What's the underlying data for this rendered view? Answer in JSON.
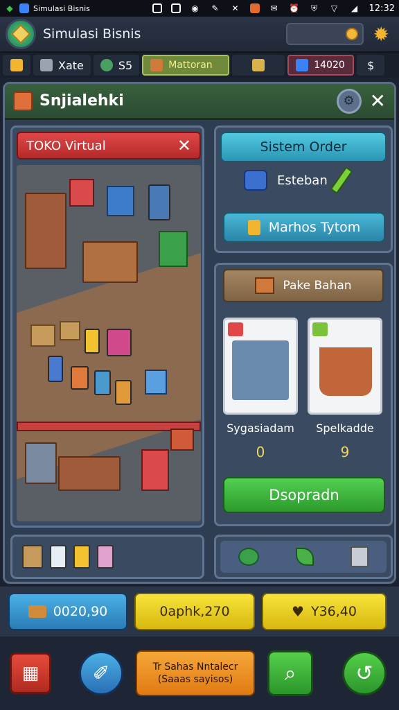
{
  "status_bar": {
    "app_name": "Simulasi Bisnis",
    "time": "12:32"
  },
  "header": {
    "title": "Simulasi Bisnis"
  },
  "resources": [
    {
      "label": "",
      "icon": "trophy-icon"
    },
    {
      "label": "Xate",
      "icon": "puzzle-icon"
    },
    {
      "label": "S5",
      "icon": "badge-icon"
    },
    {
      "label": "Mattoran",
      "icon": "crate-icon"
    },
    {
      "label": "",
      "icon": "bell-icon"
    },
    {
      "label": "14020",
      "icon": "tv-icon"
    },
    {
      "label": "",
      "icon": "dollar-icon"
    }
  ],
  "panel": {
    "title": "Snjialehki"
  },
  "store": {
    "title": "TOKO Virtual"
  },
  "right": {
    "top_title": "Sistem Order",
    "middle_label": "Esteban",
    "second_button": "Marhos Tytom",
    "header_button": "Pake Bahan",
    "tiles": [
      {
        "label": "Sygasiadam",
        "count": "0",
        "badge_color": "#e04848"
      },
      {
        "label": "Spelkadde",
        "count": "9",
        "badge_color": "#7bc23a"
      }
    ],
    "action_button": "Dsopradn"
  },
  "currency": [
    {
      "value": "0020,90",
      "style": "blue"
    },
    {
      "value": "0aphk,270",
      "style": "yellow"
    },
    {
      "value": "Y36,40",
      "style": "yellow"
    }
  ],
  "nav": {
    "center_line1": "Tr Sahas Nntalecr",
    "center_line2": "(Saaas sayisos)"
  },
  "colors": {
    "panel_header": "#38603c",
    "store_tab": "#e04848",
    "cyan_button": "#52c9e0",
    "green_button": "#52d052",
    "yellow_currency": "#f7e43a"
  }
}
